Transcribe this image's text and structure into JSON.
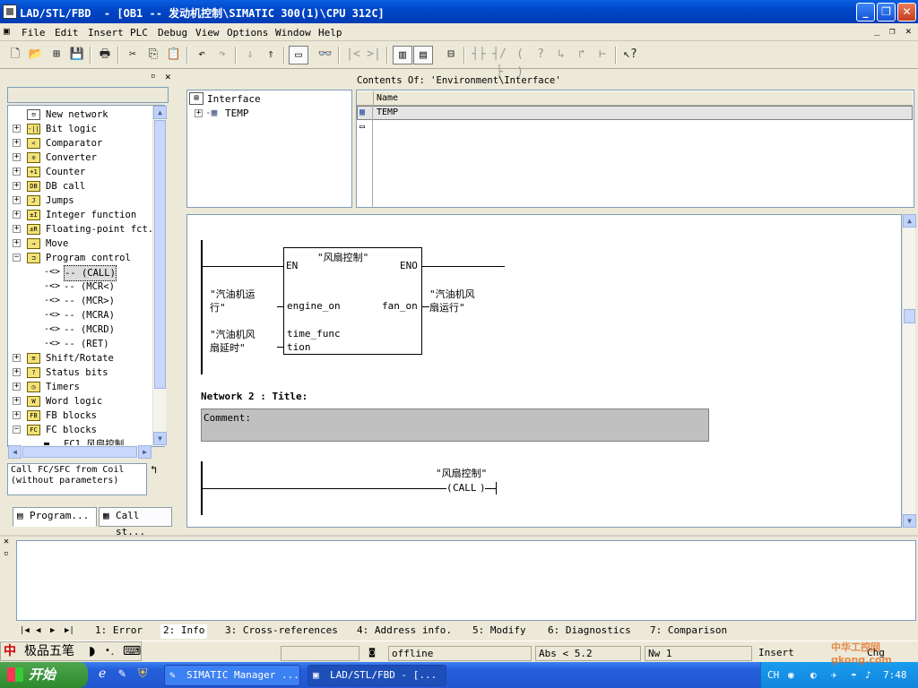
{
  "window": {
    "title": "LAD/STL/FBD  - [OB1 -- 发动机控制\\SIMATIC 300(1)\\CPU 312C]"
  },
  "menu": [
    "File",
    "Edit",
    "Insert",
    "PLC",
    "Debug",
    "View",
    "Options",
    "Window",
    "Help"
  ],
  "catalog": {
    "items": [
      {
        "label": "New network",
        "icon": "network-icon",
        "expander": ""
      },
      {
        "label": "Bit logic",
        "icon": "bit-logic-icon",
        "expander": "+"
      },
      {
        "label": "Comparator",
        "icon": "comparator-icon",
        "expander": "+"
      },
      {
        "label": "Converter",
        "icon": "converter-icon",
        "expander": "+"
      },
      {
        "label": "Counter",
        "icon": "counter-icon",
        "expander": "+"
      },
      {
        "label": "DB call",
        "icon": "db-call-icon",
        "expander": "+"
      },
      {
        "label": "Jumps",
        "icon": "jumps-icon",
        "expander": "+"
      },
      {
        "label": "Integer function",
        "icon": "integer-icon",
        "expander": "+"
      },
      {
        "label": "Floating-point fct.",
        "icon": "floating-point-icon",
        "expander": "+"
      },
      {
        "label": "Move",
        "icon": "move-icon",
        "expander": "+"
      },
      {
        "label": "Program control",
        "icon": "program-control-icon",
        "expander": "-"
      },
      {
        "label": "-- (CALL)",
        "icon": "coil-icon",
        "expander": "child"
      },
      {
        "label": "-- (MCR<)",
        "icon": "coil-icon",
        "expander": "child"
      },
      {
        "label": "-- (MCR>)",
        "icon": "coil-icon",
        "expander": "child"
      },
      {
        "label": "-- (MCRA)",
        "icon": "coil-icon",
        "expander": "child"
      },
      {
        "label": "-- (MCRD)",
        "icon": "coil-icon",
        "expander": "child"
      },
      {
        "label": "-- (RET)",
        "icon": "coil-icon",
        "expander": "child"
      },
      {
        "label": "Shift/Rotate",
        "icon": "shift-icon",
        "expander": "+"
      },
      {
        "label": "Status bits",
        "icon": "status-bits-icon",
        "expander": "+"
      },
      {
        "label": "Timers",
        "icon": "timers-icon",
        "expander": "+"
      },
      {
        "label": "Word logic",
        "icon": "word-logic-icon",
        "expander": "+"
      },
      {
        "label": "FB blocks",
        "icon": "fb-blocks-icon",
        "expander": "+"
      },
      {
        "label": "FC blocks",
        "icon": "fc-blocks-icon",
        "expander": "-"
      },
      {
        "label": "FC1   风扇控制",
        "icon": "fc1-icon",
        "expander": "child"
      }
    ],
    "description": "Call FC/SFC from Coil (without parameters)",
    "tabs": [
      "Program...",
      "Call st..."
    ]
  },
  "interface": {
    "root": "Interface",
    "child": "TEMP",
    "contents_label": "Contents Of: 'Environment\\Interface'",
    "column_name": "Name",
    "rows": [
      "TEMP"
    ]
  },
  "ladder": {
    "block_title": "\"风扇控制\"",
    "en": "EN",
    "eno": "ENO",
    "in1_label": "\"汽油机运\n行\"",
    "in1_pin": "engine_on",
    "out1_pin": "fan_on",
    "out1_label": "\"汽油机风\n扇运行\"",
    "in2_label": "\"汽油机风\n扇延时\"",
    "in2_pin": "time_func\ntion",
    "network2_title": "Network 2 : Title:",
    "comment_label": "Comment:",
    "call_title": "\"风扇控制\"",
    "call_label": "CALL"
  },
  "bottom_tabs": [
    "1: Error",
    "2: Info",
    "3: Cross-references",
    "4: Address info.",
    "5: Modify",
    "6: Diagnostics",
    "7: Comparison"
  ],
  "status": {
    "ime": "极品五笔",
    "mode": "offline",
    "abs": "Abs < 5.2",
    "nw": "Nw 1",
    "insert": "Insert",
    "chg": "Chg"
  },
  "taskbar": {
    "start": "开始",
    "tasks": [
      "SIMATIC Manager ...",
      "LAD/STL/FBD  - [..."
    ],
    "lang": "CH",
    "time": "7:48"
  },
  "watermark": "中华工控网 gkong.com"
}
